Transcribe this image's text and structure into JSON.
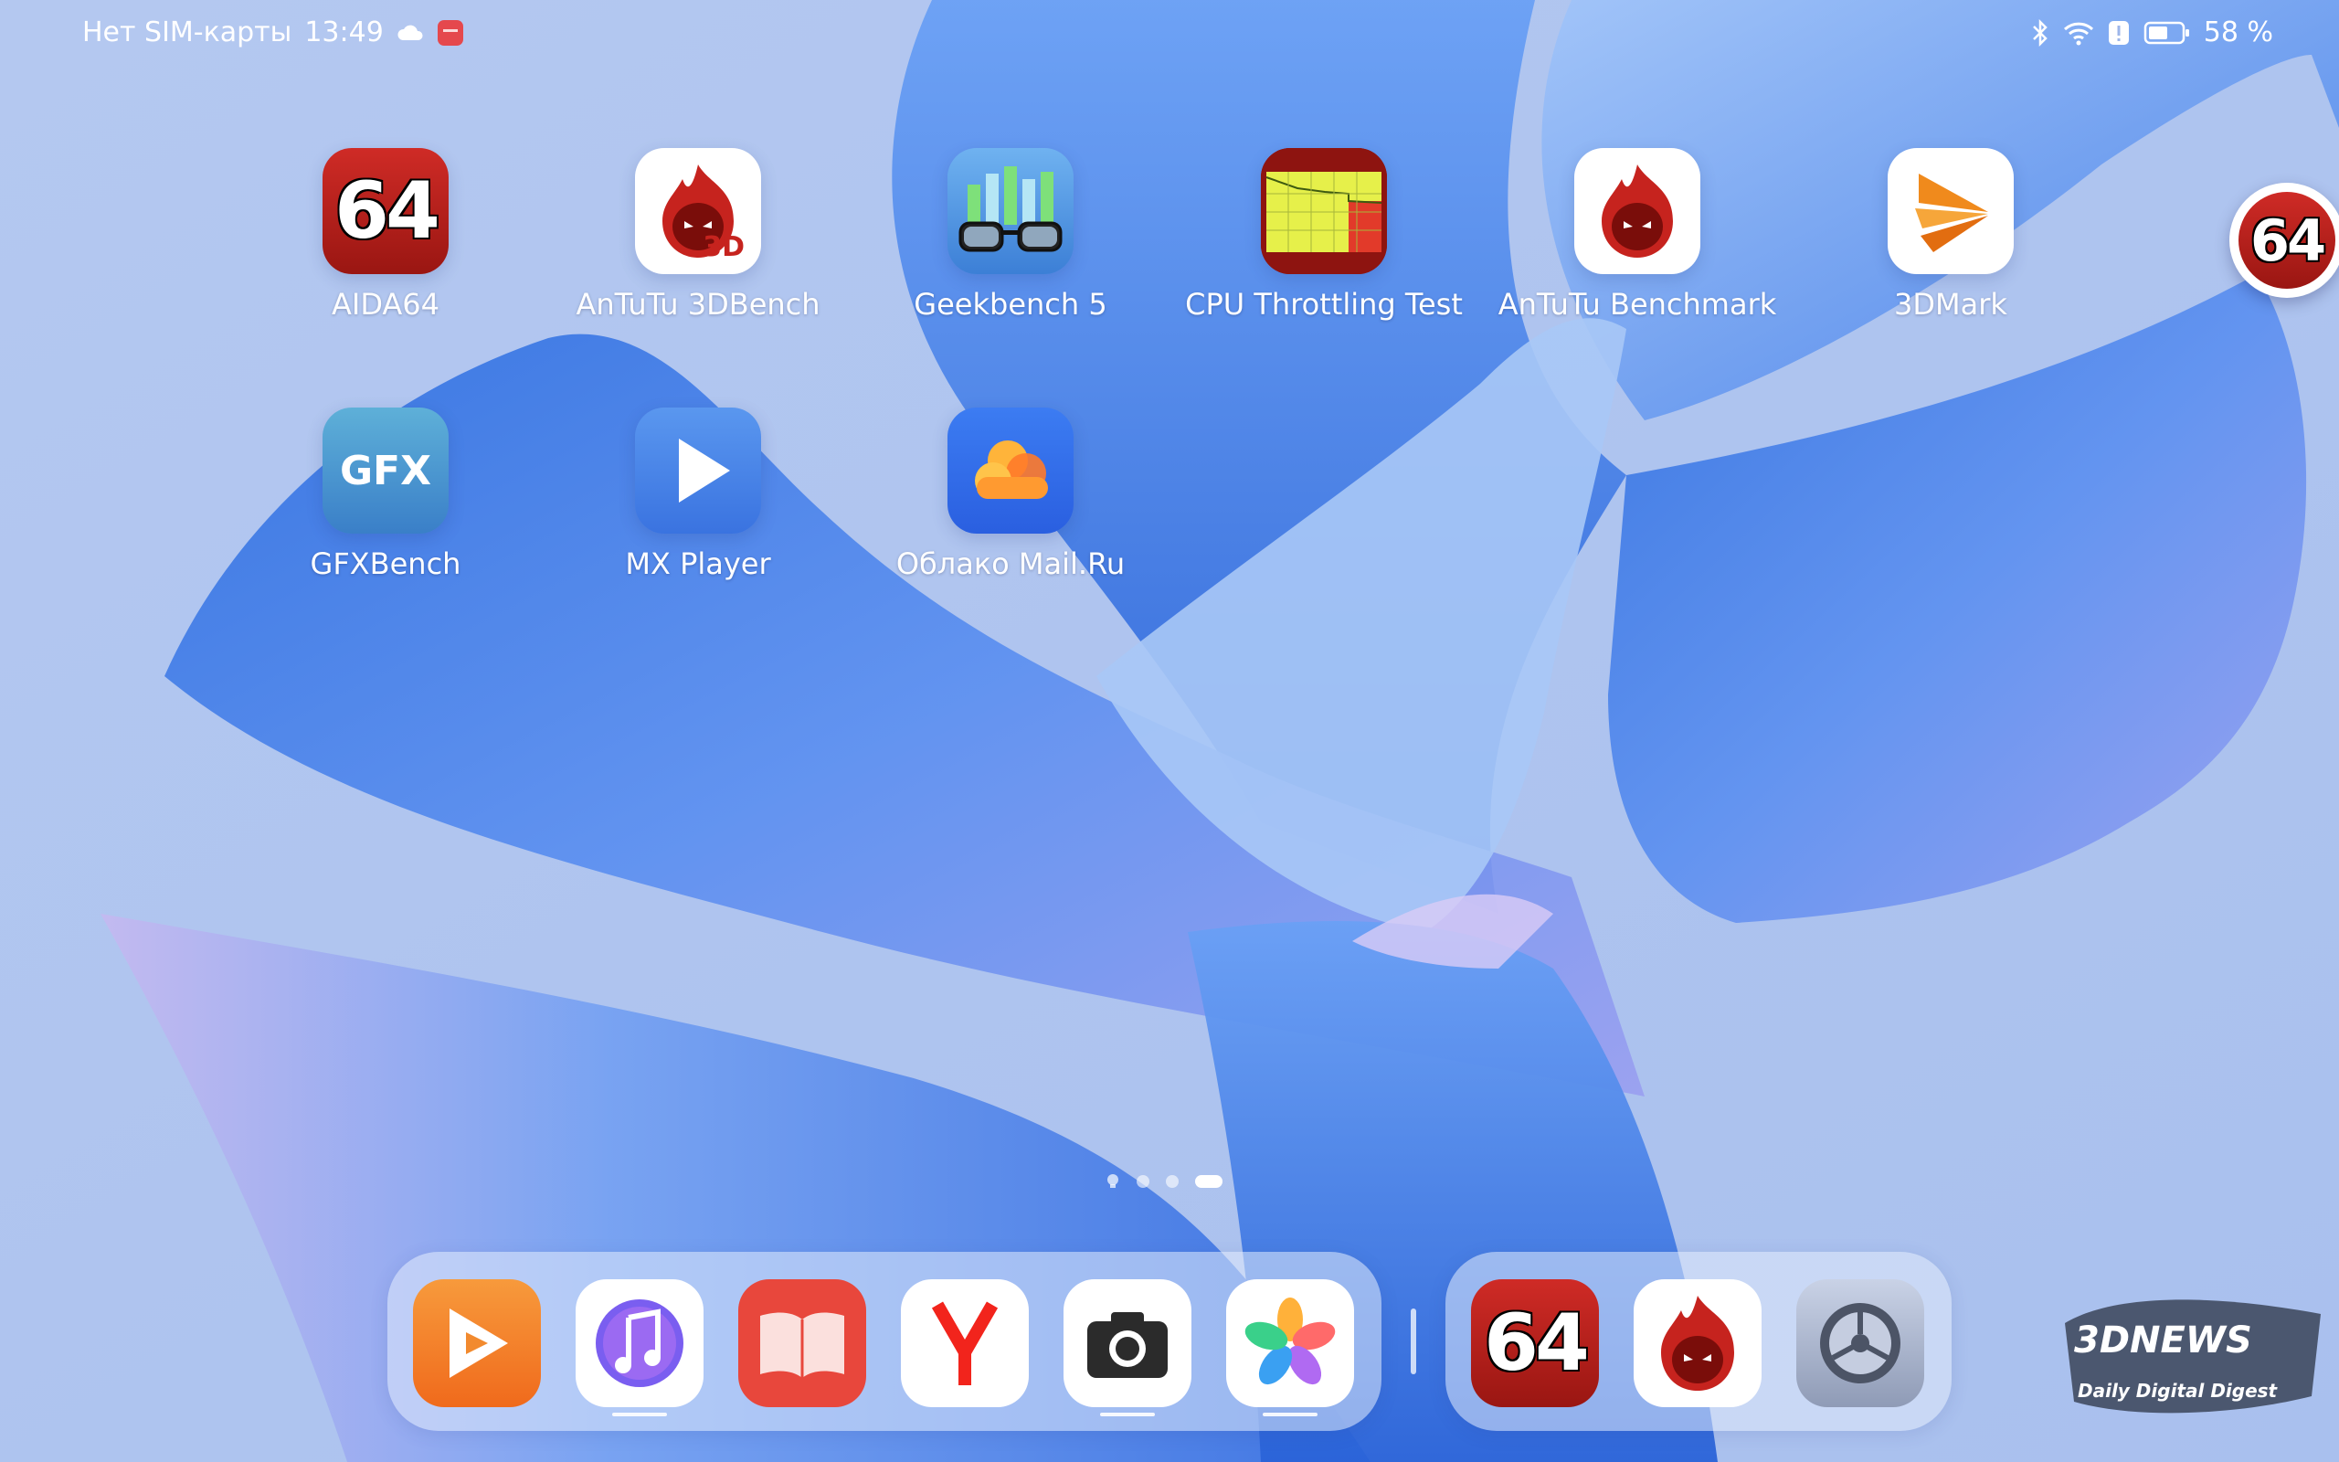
{
  "status_bar": {
    "carrier": "Нет SIM-карты",
    "time": "13:49",
    "battery": "58 %"
  },
  "home_apps": [
    {
      "label": "AIDA64",
      "icon": "aida64-icon",
      "icon_text": "64"
    },
    {
      "label": "AnTuTu 3DBench",
      "icon": "antutu-3dbench-icon",
      "icon_text": "3D"
    },
    {
      "label": "Geekbench 5",
      "icon": "geekbench-icon"
    },
    {
      "label": "CPU Throttling Test",
      "icon": "cpu-throttling-icon"
    },
    {
      "label": "AnTuTu Benchmark",
      "icon": "antutu-icon"
    },
    {
      "label": "3DMark",
      "icon": "3dmark-icon"
    },
    {
      "label": "GFXBench",
      "icon": "gfxbench-icon",
      "icon_text": "GFX"
    },
    {
      "label": "MX Player",
      "icon": "mx-player-icon"
    },
    {
      "label": "Облако Mail.Ru",
      "icon": "mail-cloud-icon"
    }
  ],
  "edge_bubble": {
    "icon": "aida64-floating-icon",
    "icon_text": "64"
  },
  "page_indicator": {
    "count": 4,
    "active_index": 3
  },
  "dock_left": [
    {
      "icon": "huawei-video-icon"
    },
    {
      "icon": "music-icon"
    },
    {
      "icon": "books-icon"
    },
    {
      "icon": "yandex-browser-icon",
      "icon_text": "Y"
    },
    {
      "icon": "camera-icon"
    },
    {
      "icon": "gallery-icon"
    }
  ],
  "dock_right": [
    {
      "icon": "aida64-icon",
      "icon_text": "64"
    },
    {
      "icon": "antutu-icon"
    },
    {
      "icon": "settings-icon"
    }
  ],
  "watermark": {
    "logo_text": "3DNEWS",
    "tagline": "Daily Digital Digest"
  }
}
